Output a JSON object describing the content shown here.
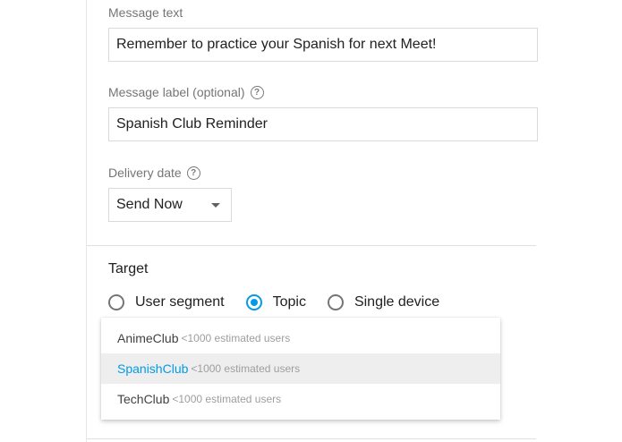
{
  "form": {
    "message_text_label": "Message text",
    "message_text_value": "Remember to practice your Spanish for next Meet!",
    "message_label_label": "Message label (optional)",
    "message_label_value": "Spanish Club Reminder",
    "delivery_date_label": "Delivery date",
    "delivery_date_value": "Send Now",
    "help_glyph": "?"
  },
  "target": {
    "title": "Target",
    "options": [
      {
        "label": "User segment",
        "checked": false
      },
      {
        "label": "Topic",
        "checked": true
      },
      {
        "label": "Single device",
        "checked": false
      }
    ]
  },
  "topic_dropdown": {
    "items": [
      {
        "name": "AnimeClub",
        "meta": "<1000 estimated users",
        "active": false
      },
      {
        "name": "SpanishClub",
        "meta": "<1000 estimated users",
        "active": true
      },
      {
        "name": "TechClub",
        "meta": "<1000 estimated users",
        "active": false
      }
    ]
  },
  "colors": {
    "accent": "#039be5",
    "text": "#212121",
    "muted": "#757575",
    "highlight_bg": "#eeeeee"
  },
  "icons": {
    "help": "help-circle-icon",
    "caret": "arrow-drop-down-icon"
  }
}
